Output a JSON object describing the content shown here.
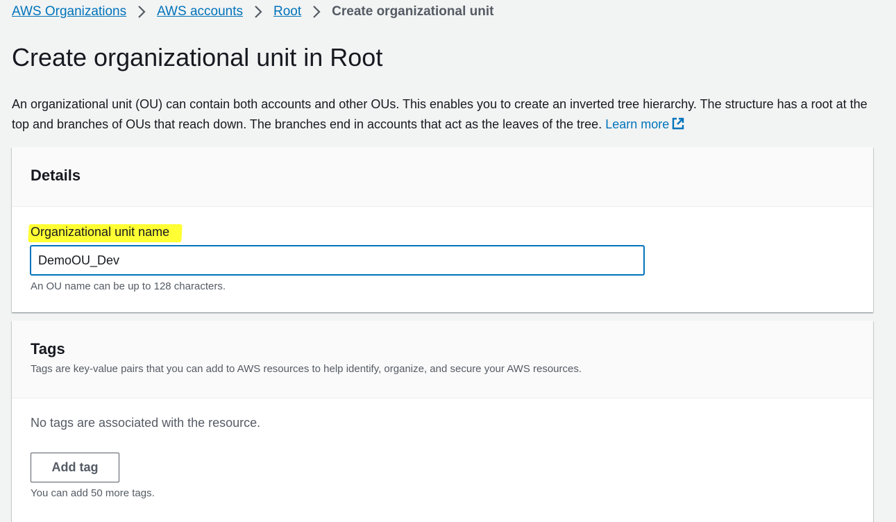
{
  "breadcrumb": {
    "items": [
      {
        "label": "AWS Organizations"
      },
      {
        "label": "AWS accounts"
      },
      {
        "label": "Root"
      }
    ],
    "current": "Create organizational unit"
  },
  "page": {
    "title": "Create organizational unit in Root",
    "description": "An organizational unit (OU) can contain both accounts and other OUs. This enables you to create an inverted tree hierarchy. The structure has a root at the top and branches of OUs that reach down. The branches end in accounts that act as the leaves of the tree.",
    "learn_more": "Learn more"
  },
  "details": {
    "heading": "Details",
    "ou_name_label": "Organizational unit name",
    "ou_name_value": "DemoOU_Dev",
    "ou_name_constraint": "An OU name can be up to 128 characters."
  },
  "tags": {
    "heading": "Tags",
    "description": "Tags are key-value pairs that you can add to AWS resources to help identify, organize, and secure your AWS resources.",
    "empty_message": "No tags are associated with the resource.",
    "add_button": "Add tag",
    "limit_text": "You can add 50 more tags."
  },
  "colors": {
    "link": "#0073bb",
    "highlight": "#ffff33",
    "background": "#f2f3f3"
  },
  "icons": {
    "breadcrumb_separator": "chevron-right-icon",
    "learn_more": "external-link-icon"
  }
}
